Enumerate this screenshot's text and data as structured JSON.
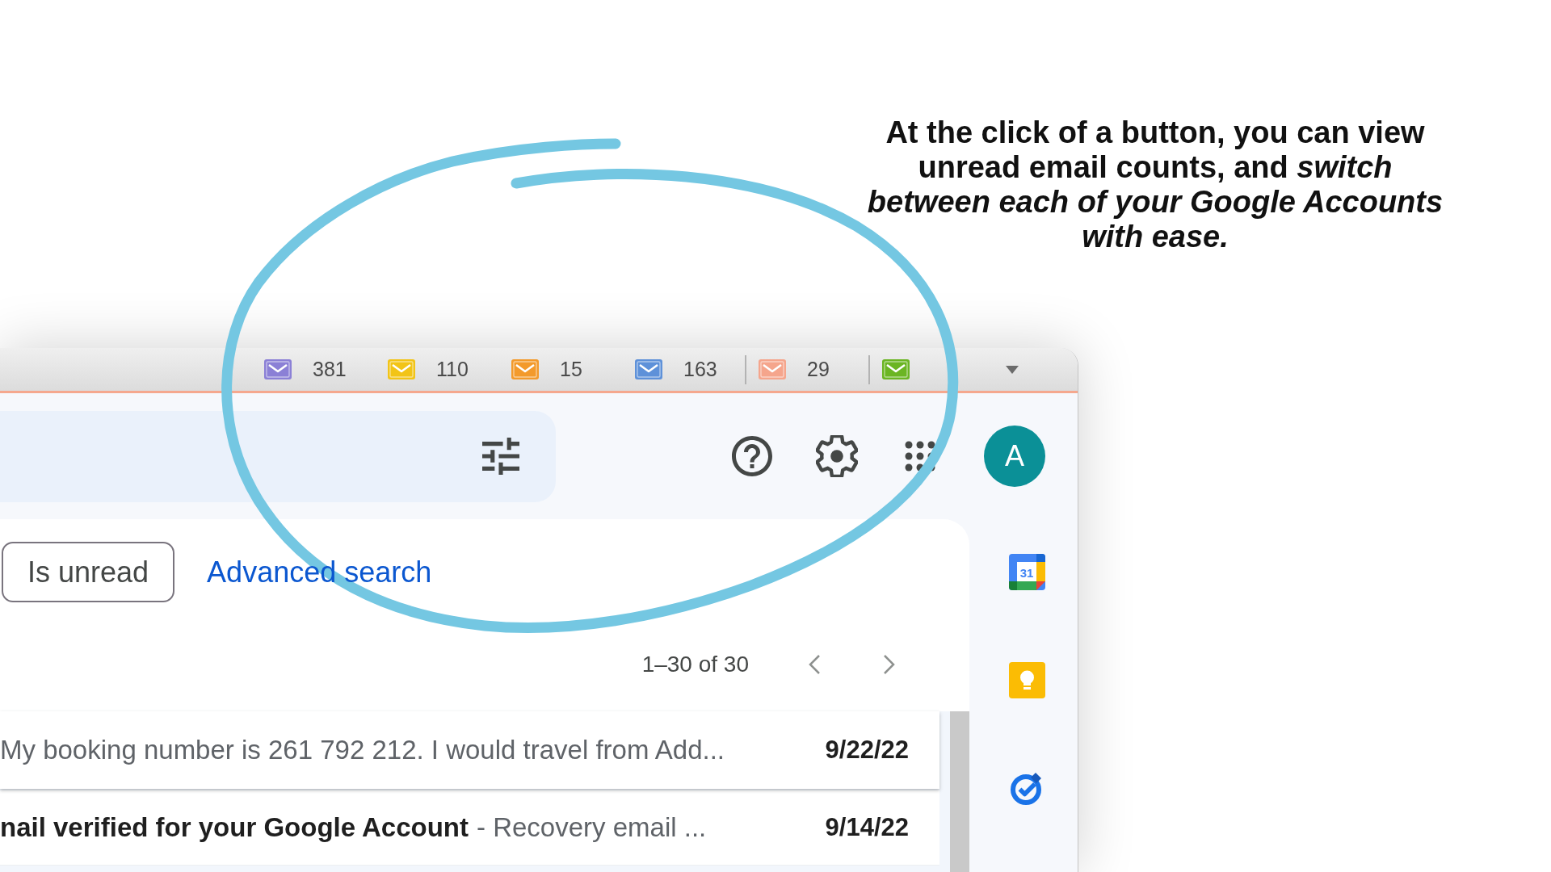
{
  "caption": {
    "text": "At the click of a button, you can view unread email counts, and *switch between each of your Google Accounts with ease.*"
  },
  "extension_bar": {
    "items": [
      {
        "kind": "account",
        "color": "#8b80d6",
        "count": "381"
      },
      {
        "kind": "account",
        "color": "#f2c417",
        "count": "110"
      },
      {
        "kind": "account",
        "color": "#f39a2b",
        "count": "15"
      },
      {
        "kind": "account",
        "color": "#5e91d9",
        "count": "163"
      },
      {
        "kind": "separator"
      },
      {
        "kind": "account",
        "color": "#f5a58c",
        "count": "29"
      },
      {
        "kind": "separator"
      },
      {
        "kind": "account",
        "color": "#6bb523"
      }
    ]
  },
  "header": {
    "avatar": "A"
  },
  "filters": {
    "chips": [
      {
        "label": "Is unread"
      }
    ],
    "link": "Advanced search"
  },
  "pagination": {
    "range": "1–30 of 30"
  },
  "emails": [
    {
      "snippet": "My booking number is 261 792 212. I would travel from Add...",
      "date": "9/22/22",
      "unread": true,
      "hovered": true
    },
    {
      "subject": "nail verified for your Google Account",
      "snippet": "- Recovery email ...",
      "date": "9/14/22",
      "unread": true,
      "hovered": false
    }
  ],
  "side_panel": [
    {
      "kind": "calendar",
      "label": "31"
    },
    {
      "kind": "bulb"
    },
    {
      "kind": "check"
    }
  ]
}
